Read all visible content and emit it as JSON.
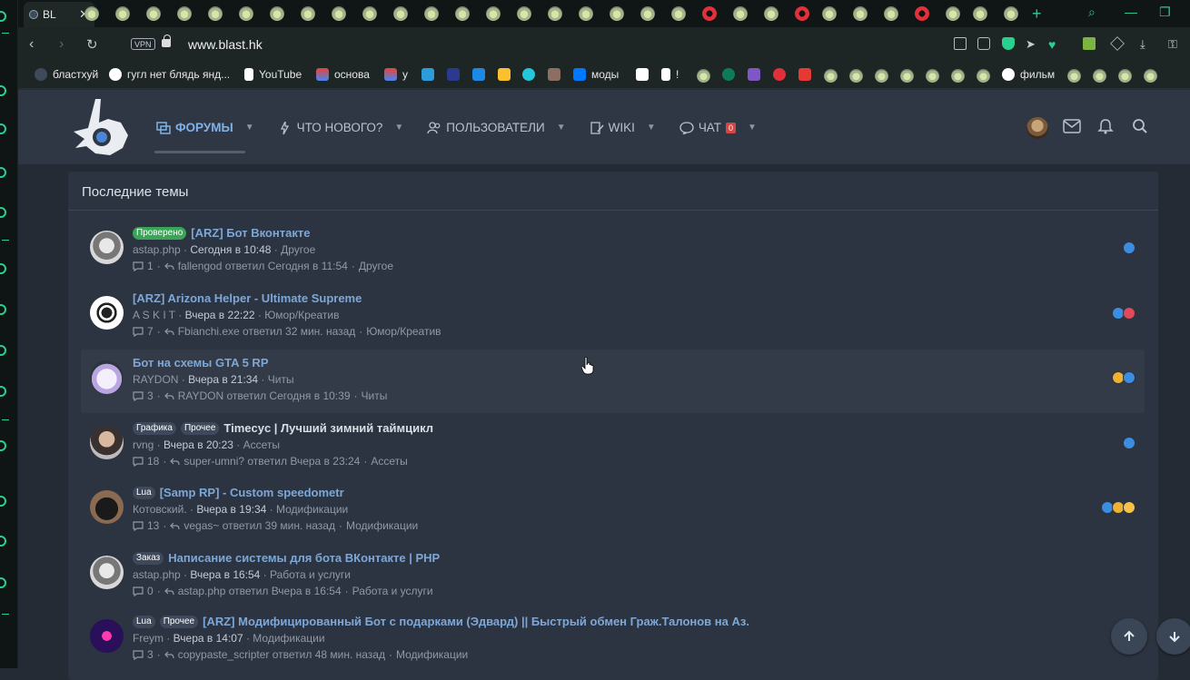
{
  "browser": {
    "active_tab_label": "BL",
    "url": "www.blast.hk",
    "vpn_label": "VPN",
    "bookmarks": [
      {
        "label": "бластхуй"
      },
      {
        "label": "гугл нет блядь янд..."
      },
      {
        "label": "YouTube"
      },
      {
        "label": "основа"
      },
      {
        "label": "у"
      },
      {
        "label": "моды"
      },
      {
        "label": "!"
      },
      {
        "label": "фильм"
      }
    ]
  },
  "site": {
    "nav": [
      {
        "label": "ФОРУМЫ",
        "active": true
      },
      {
        "label": "ЧТО НОВОГО?"
      },
      {
        "label": "ПОЛЬЗОВАТЕЛИ"
      },
      {
        "label": "WIKI"
      },
      {
        "label": "ЧАТ",
        "badge": "0"
      }
    ]
  },
  "block_title": "Последние темы",
  "threads": [
    {
      "labels": [
        {
          "text": "Проверено",
          "style": "green"
        }
      ],
      "title": "[ARZ] Бот Вконтакте",
      "author": "astap.php",
      "date": "Сегодня в 10:48",
      "forum": "Другое",
      "replies": "1",
      "last": "fallengod ответил Сегодня в 11:54",
      "last_forum": "Другое",
      "reactions": [
        "like"
      ]
    },
    {
      "labels": [],
      "title": "[ARZ] Arizona Helper - Ultimate Supreme",
      "author": "A S K I T",
      "date": "Вчера в 22:22",
      "forum": "Юмор/Креатив",
      "replies": "7",
      "last": "Fbianchi.exe ответил 32 мин. назад",
      "last_forum": "Юмор/Креатив",
      "reactions": [
        "like",
        "love"
      ]
    },
    {
      "labels": [],
      "title": "Бот на схемы GTA 5 RP",
      "author": "RAYDON",
      "date": "Вчера в 21:34",
      "forum": "Читы",
      "replies": "3",
      "last": "RAYDON ответил Сегодня в 10:39",
      "last_forum": "Читы",
      "reactions": [
        "star",
        "like"
      ]
    },
    {
      "labels": [
        {
          "text": "Графика"
        },
        {
          "text": "Прочее"
        }
      ],
      "title": "Timecyc | Лучший зимний таймцикл",
      "title_plain": true,
      "author": "rvng",
      "date": "Вчера в 20:23",
      "forum": "Ассеты",
      "replies": "18",
      "last": "super-umni? ответил Вчера в 23:24",
      "last_forum": "Ассеты",
      "reactions": [
        "like"
      ]
    },
    {
      "labels": [
        {
          "text": "Lua"
        }
      ],
      "title": "[Samp RP] - Custom speedometr",
      "author": "Котовский.",
      "date": "Вчера в 19:34",
      "forum": "Модификации",
      "replies": "13",
      "last": "vegas~ ответил 39 мин. назад",
      "last_forum": "Модификации",
      "reactions": [
        "like",
        "star",
        "sad"
      ]
    },
    {
      "labels": [
        {
          "text": "Заказ"
        }
      ],
      "title": "Написание системы для бота ВКонтакте | PHP",
      "author": "astap.php",
      "date": "Вчера в 16:54",
      "forum": "Работа и услуги",
      "replies": "0",
      "last": "astap.php ответил Вчера в 16:54",
      "last_forum": "Работа и услуги",
      "reactions": []
    },
    {
      "labels": [
        {
          "text": "Lua"
        },
        {
          "text": "Прочее"
        }
      ],
      "title": "[ARZ] Модифицированный Бот с подарками (Эдвард) || Быстрый обмен Граж.Талонов на Аз.",
      "author": "Freym",
      "date": "Вчера в 14:07",
      "forum": "Модификации",
      "replies": "3",
      "last": "copypaste_scripter ответил 48 мин. назад",
      "last_forum": "Модификации",
      "reactions": [
        "like"
      ]
    }
  ]
}
